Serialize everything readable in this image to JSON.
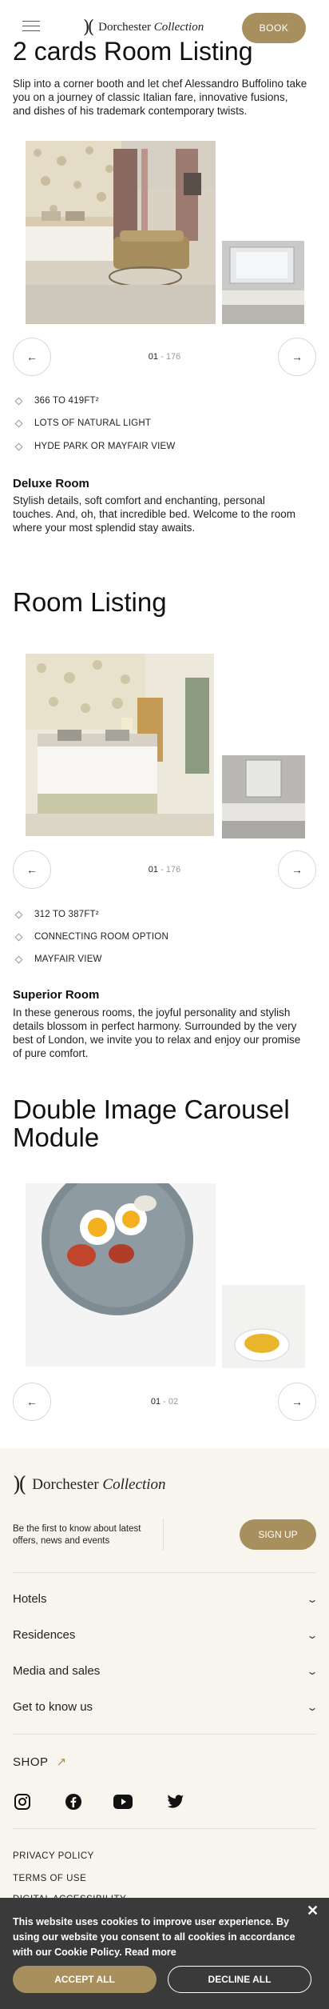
{
  "header": {
    "logo_main": "Dorchester",
    "logo_italic": "Collection",
    "book_label": "BOOK"
  },
  "section1": {
    "title": "2 cards Room Listing",
    "intro": "Slip into a corner booth and let chef Alessandro Buffolino take you on a journey of classic Italian fare, innovative fusions, and dishes of his trademark contemporary twists.",
    "counter_current": "01",
    "counter_sep": " - ",
    "counter_total": "176",
    "features": [
      "366 TO 419FT²",
      "LOTS OF NATURAL LIGHT",
      "HYDE PARK OR MAYFAIR VIEW"
    ],
    "room_title": "Deluxe Room",
    "room_desc": "Stylish details, soft comfort and enchanting, personal touches. And, oh, that incredible bed. Welcome to the room where your most splendid stay awaits."
  },
  "section2": {
    "title": "Room Listing",
    "counter_current": "01",
    "counter_sep": " - ",
    "counter_total": "176",
    "features": [
      "312 TO 387FT²",
      "CONNECTING ROOM OPTION",
      "MAYFAIR VIEW"
    ],
    "room_title": "Superior Room",
    "room_desc": "In these generous rooms, the joyful personality and stylish details blossom in perfect harmony. Surrounded by the very best of London, we invite you to relax and enjoy our promise of pure comfort."
  },
  "section3": {
    "title_line1": "Double Image Carousel",
    "title_line2": "Module",
    "counter_current": "01",
    "counter_sep": " - ",
    "counter_total": "02"
  },
  "footer": {
    "logo_main": "Dorchester",
    "logo_italic": "Collection",
    "newsletter_text": "Be the first to know about latest offers, news and events",
    "signup_label": "SIGN UP",
    "links": [
      "Hotels",
      "Residences",
      "Media and sales",
      "Get to know us"
    ],
    "shop_label": "SHOP",
    "legal": [
      "PRIVACY POLICY",
      "TERMS OF USE",
      "DIGITAL ACCESSIBILITY"
    ]
  },
  "cookie": {
    "text": "This website uses cookies to improve user experience. By using our website you consent to all cookies in accordance with our Cookie Policy. Read more",
    "accept_label": "ACCEPT ALL",
    "decline_label": "DECLINE ALL"
  },
  "colors": {
    "accent": "#a88f5e",
    "footer_bg": "#f7f5ee",
    "cookie_bg": "#3a3a3a"
  }
}
